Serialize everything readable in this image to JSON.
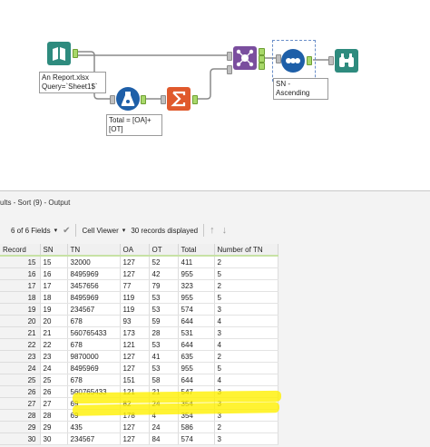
{
  "canvas": {
    "input_annotation": [
      "An Report.xlsx",
      "Query=`Sheet1$`"
    ],
    "summarize_annotation": [
      "Total = [OA]+",
      "[OT]"
    ],
    "sort_annotation": "SN - Ascending",
    "join_labels": [
      "L",
      "J",
      "R"
    ],
    "colors": {
      "input": "#2e8b7e",
      "formula": "#1e5fa8",
      "summarize": "#e0592c",
      "join": "#7a4e9e",
      "sort": "#1e5fa8",
      "browse": "#2e8b7e"
    }
  },
  "results": {
    "title": "ults - Sort (9) - Output",
    "toolbar": {
      "fields_label": "6 of 6 Fields",
      "viewer_label": "Cell Viewer",
      "records_label": "30 records displayed"
    },
    "columns": [
      "Record",
      "SN",
      "TN",
      "OA",
      "OT",
      "Total",
      "Number of TN"
    ],
    "rows": [
      [
        "15",
        "15",
        "32000",
        "127",
        "52",
        "411",
        "2"
      ],
      [
        "16",
        "16",
        "8495969",
        "127",
        "42",
        "955",
        "5"
      ],
      [
        "17",
        "17",
        "3457656",
        "77",
        "79",
        "323",
        "2"
      ],
      [
        "18",
        "18",
        "8495969",
        "119",
        "53",
        "955",
        "5"
      ],
      [
        "19",
        "19",
        "234567",
        "119",
        "53",
        "574",
        "3"
      ],
      [
        "20",
        "20",
        "678",
        "93",
        "59",
        "644",
        "4"
      ],
      [
        "21",
        "21",
        "560765433",
        "173",
        "28",
        "531",
        "3"
      ],
      [
        "22",
        "22",
        "678",
        "121",
        "53",
        "644",
        "4"
      ],
      [
        "23",
        "23",
        "9870000",
        "127",
        "41",
        "635",
        "2"
      ],
      [
        "24",
        "24",
        "8495969",
        "127",
        "53",
        "955",
        "5"
      ],
      [
        "25",
        "25",
        "678",
        "151",
        "58",
        "644",
        "4"
      ],
      [
        "26",
        "26",
        "560765433",
        "121",
        "21",
        "547",
        "3"
      ],
      [
        "27",
        "27",
        "69",
        "82",
        "24",
        "354",
        "3"
      ],
      [
        "28",
        "28",
        "69",
        "178",
        "4",
        "354",
        "3"
      ],
      [
        "29",
        "29",
        "435",
        "127",
        "24",
        "586",
        "2"
      ],
      [
        "30",
        "30",
        "234567",
        "127",
        "84",
        "574",
        "3"
      ]
    ],
    "highlight_color": "#fff000"
  }
}
